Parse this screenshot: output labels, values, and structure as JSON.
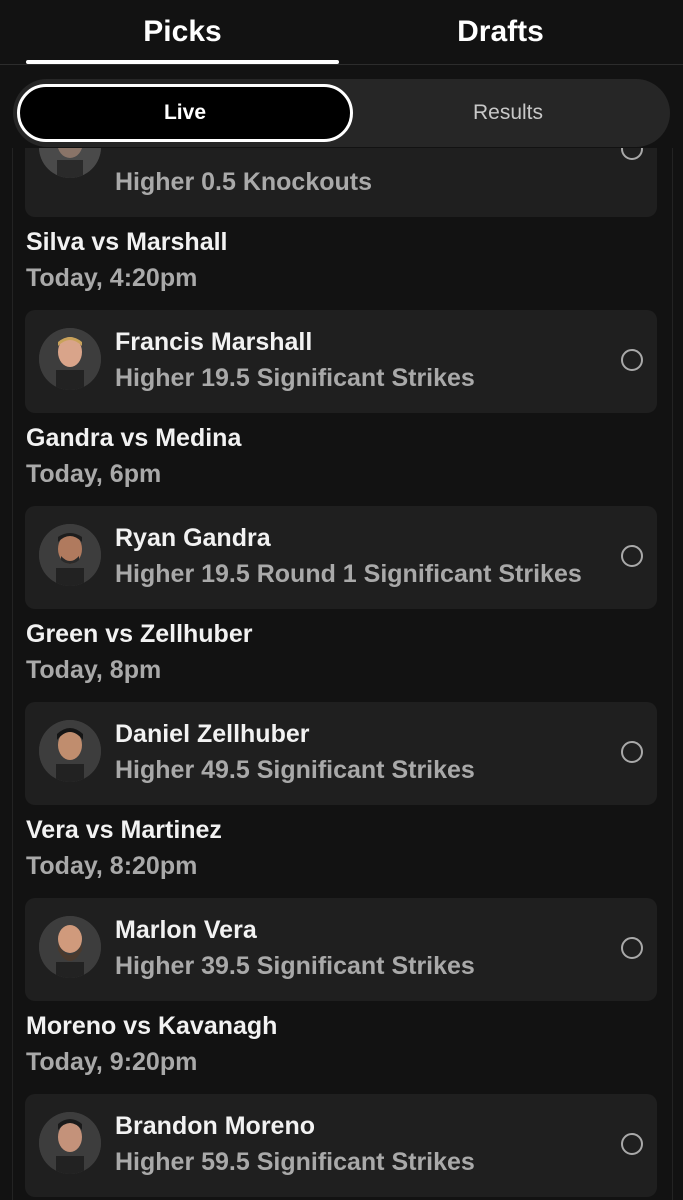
{
  "tabs": {
    "picks": "Picks",
    "drafts": "Drafts"
  },
  "segment": {
    "live": "Live",
    "results": "Results"
  },
  "partial_card": {
    "pick": "Higher 0.5 Knockouts"
  },
  "matches": [
    {
      "title": "Silva vs Marshall",
      "time": "Today, 4:20pm",
      "player": "Francis Marshall",
      "pick": "Higher 19.5 Significant Strikes"
    },
    {
      "title": "Gandra vs Medina",
      "time": "Today, 6pm",
      "player": "Ryan Gandra",
      "pick": "Higher 19.5 Round 1 Significant Strikes"
    },
    {
      "title": "Green vs Zellhuber",
      "time": "Today, 8pm",
      "player": "Daniel Zellhuber",
      "pick": "Higher 49.5 Significant Strikes"
    },
    {
      "title": "Vera vs Martinez",
      "time": "Today, 8:20pm",
      "player": "Marlon Vera",
      "pick": "Higher 39.5 Significant Strikes"
    },
    {
      "title": "Moreno vs Kavanagh",
      "time": "Today, 9:20pm",
      "player": "Brandon Moreno",
      "pick": "Higher 59.5 Significant Strikes"
    }
  ],
  "colors": {
    "background": "#121212",
    "card": "#1f1f1f",
    "primary_text": "#f2f2f2",
    "secondary_text": "#a9a9a9"
  },
  "icons": {
    "radio": "radio-unselected-icon",
    "avatar": "fighter-avatar"
  }
}
